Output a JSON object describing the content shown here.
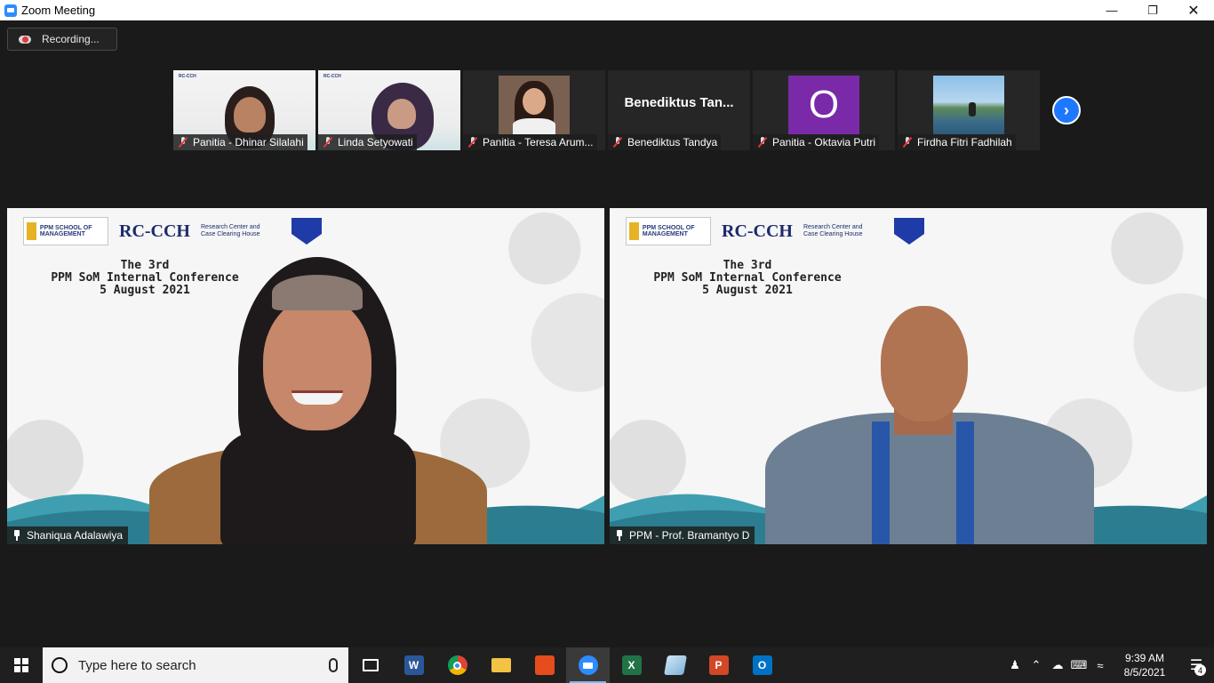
{
  "window": {
    "title": "Zoom Meeting",
    "controls": [
      "minimize",
      "restore",
      "close"
    ]
  },
  "recording": {
    "label": "Recording..."
  },
  "thumbnails": [
    {
      "name": "Panitia - Dhinar Silalahi",
      "kind": "video-conf"
    },
    {
      "name": "Linda Setyowati",
      "kind": "video-conf"
    },
    {
      "name": "Panitia - Teresa Arum...",
      "kind": "video"
    },
    {
      "name": "Benediktus Tandya",
      "kind": "name-only",
      "display": "Benediktus  Tan..."
    },
    {
      "name": "Panitia - Oktavia Putri",
      "kind": "avatar",
      "initial": "O"
    },
    {
      "name": "Firdha Fitri Fadhilah",
      "kind": "photo"
    }
  ],
  "main_videos": [
    {
      "name": "Shaniqua Adalawiya",
      "conf_line1": "The 3rd",
      "conf_line2": "PPM SoM Internal Conference",
      "conf_line3": "5 August 2021",
      "logo_text": "RC-CCH",
      "logo_sub": "Research Center and Case Clearing House",
      "school": "PPM SCHOOL OF MANAGEMENT"
    },
    {
      "name": "PPM - Prof. Bramantyo D",
      "conf_line1": "The 3rd",
      "conf_line2": "PPM SoM Internal Conference",
      "conf_line3": "5 August 2021",
      "logo_text": "RC-CCH",
      "logo_sub": "Research Center and Case Clearing House",
      "school": "PPM SCHOOL OF MANAGEMENT"
    }
  ],
  "taskbar": {
    "search_placeholder": "Type here to search",
    "apps": [
      "task-view",
      "word",
      "chrome",
      "file-explorer",
      "office",
      "zoom",
      "excel",
      "notes",
      "powerpoint",
      "outlook"
    ],
    "clock_time": "9:39 AM",
    "clock_date": "8/5/2021",
    "notification_count": "4"
  },
  "colors": {
    "zoom_blue": "#2d8cff",
    "mute_red": "#e0393e",
    "avatar_purple": "#7a2aa8",
    "next_button": "#1e78ff"
  }
}
